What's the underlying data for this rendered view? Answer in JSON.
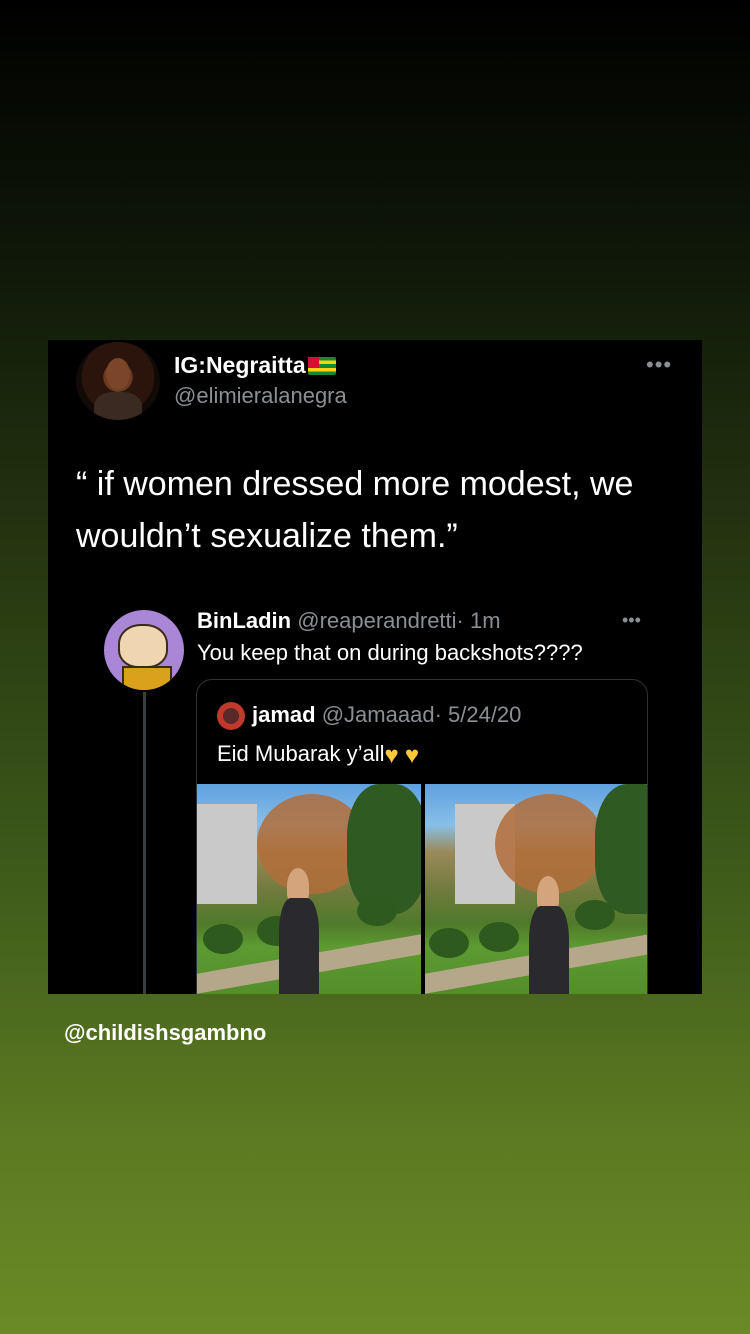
{
  "tweet": {
    "display_name": "IG:Negraitta",
    "handle": "@elimieralanegra",
    "text": "“ if women dressed more modest, we wouldn’t sexualize them.”",
    "more_icon": "•••"
  },
  "reply": {
    "display_name": "BinLadin",
    "handle": "@reaperandretti",
    "time": "· 1m",
    "text": "You keep that on during backshots????",
    "more_icon": "•••"
  },
  "quoted": {
    "display_name": "jamad",
    "handle": "@Jamaaad",
    "date": "· 5/24/20",
    "text": "Eid Mubarak y’all"
  },
  "footer": {
    "credit": "@childishsgambno"
  },
  "colors": {
    "accent_heart": "#ffc93a",
    "secondary_text": "#8b8f94"
  }
}
